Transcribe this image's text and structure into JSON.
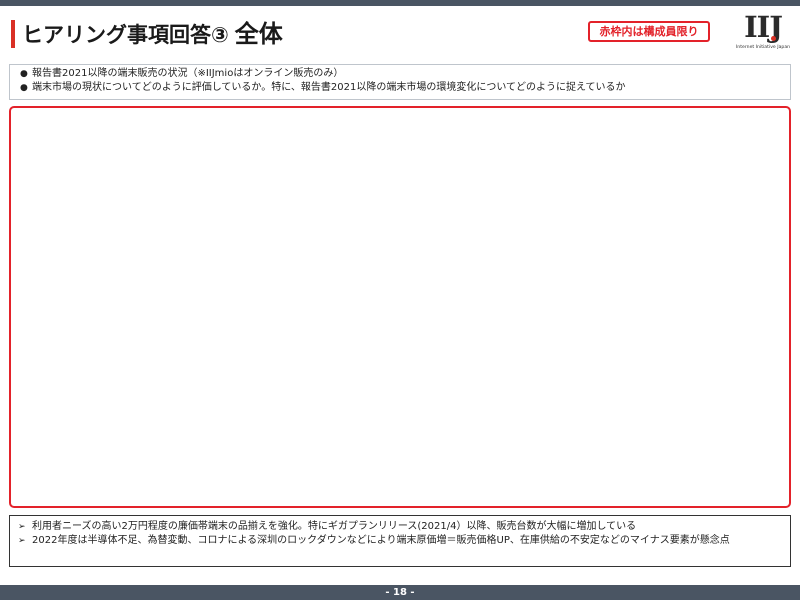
{
  "header": {
    "title_main": "ヒアリング事項回答③",
    "title_strong": "全体",
    "badge": "赤枠内は構成員限り"
  },
  "logo": {
    "mark": "IIJ",
    "subtitle": "Internet Initiative Japan"
  },
  "questions": [
    "報告書2021以降の端末販売の状況（※IIJmioはオンライン販売のみ）",
    "端末市場の現状についてどのように評価しているか。特に、報告書2021以降の端末市場の環境変化についてどのように捉えているか"
  ],
  "summary": [
    "利用者ニーズの高い2万円程度の廉価帯端末の品揃えを強化。特にギガプランリリース(2021/4）以降、販売台数が大幅に増加している",
    "2022年度は半導体不足、為替変動、コロナによる深圳のロックダウンなどにより端末原価増＝販売価格UP、在庫供給の不安定などのマイナス要素が懸念点"
  ],
  "footer": {
    "page": "- 18 -"
  },
  "colors": {
    "accent_red": "#e3222a",
    "bar_gray": "#4a5563"
  }
}
